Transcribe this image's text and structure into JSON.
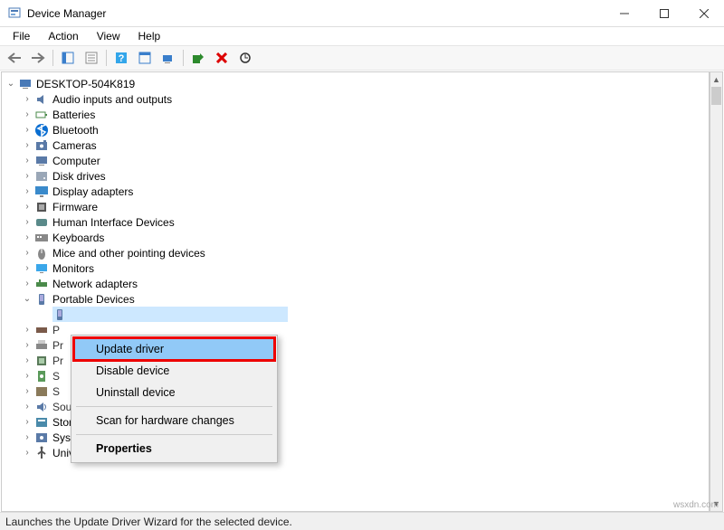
{
  "window": {
    "title": "Device Manager"
  },
  "menubar": [
    "File",
    "Action",
    "View",
    "Help"
  ],
  "root_node": "DESKTOP-504K819",
  "categories": [
    {
      "label": "Audio inputs and outputs",
      "icon": "audio-icon"
    },
    {
      "label": "Batteries",
      "icon": "battery-icon"
    },
    {
      "label": "Bluetooth",
      "icon": "bluetooth-icon"
    },
    {
      "label": "Cameras",
      "icon": "camera-icon"
    },
    {
      "label": "Computer",
      "icon": "computer-icon"
    },
    {
      "label": "Disk drives",
      "icon": "disk-icon"
    },
    {
      "label": "Display adapters",
      "icon": "display-icon"
    },
    {
      "label": "Firmware",
      "icon": "firmware-icon"
    },
    {
      "label": "Human Interface Devices",
      "icon": "hid-icon"
    },
    {
      "label": "Keyboards",
      "icon": "keyboard-icon"
    },
    {
      "label": "Mice and other pointing devices",
      "icon": "mouse-icon"
    },
    {
      "label": "Monitors",
      "icon": "monitor-icon"
    },
    {
      "label": "Network adapters",
      "icon": "network-icon"
    },
    {
      "label": "Portable Devices",
      "icon": "portable-icon",
      "expanded": true,
      "child_selected": true
    },
    {
      "label": "P",
      "icon": "port-icon",
      "clipped": true
    },
    {
      "label": "Pr",
      "icon": "printqueue-icon",
      "clipped": true
    },
    {
      "label": "Pr",
      "icon": "processor-icon",
      "clipped": true
    },
    {
      "label": "S",
      "icon": "security-icon",
      "clipped": true
    },
    {
      "label": "S",
      "icon": "software-icon",
      "clipped": true
    },
    {
      "label": "Sou..., ....... game controllers",
      "icon": "sound-icon",
      "clipped": true
    },
    {
      "label": "Storage controllers",
      "icon": "storage-icon"
    },
    {
      "label": "System devices",
      "icon": "system-icon"
    },
    {
      "label": "Universal Serial Bus controllers",
      "icon": "usb-icon",
      "cut": true
    }
  ],
  "context_menu": {
    "items": [
      {
        "label": "Update driver",
        "highlighted": true
      },
      {
        "label": "Disable device"
      },
      {
        "label": "Uninstall device"
      },
      {
        "sep": true
      },
      {
        "label": "Scan for hardware changes"
      },
      {
        "sep": true
      },
      {
        "label": "Properties",
        "bold": true
      }
    ]
  },
  "statusbar": "Launches the Update Driver Wizard for the selected device.",
  "watermark": "wsxdn.com"
}
